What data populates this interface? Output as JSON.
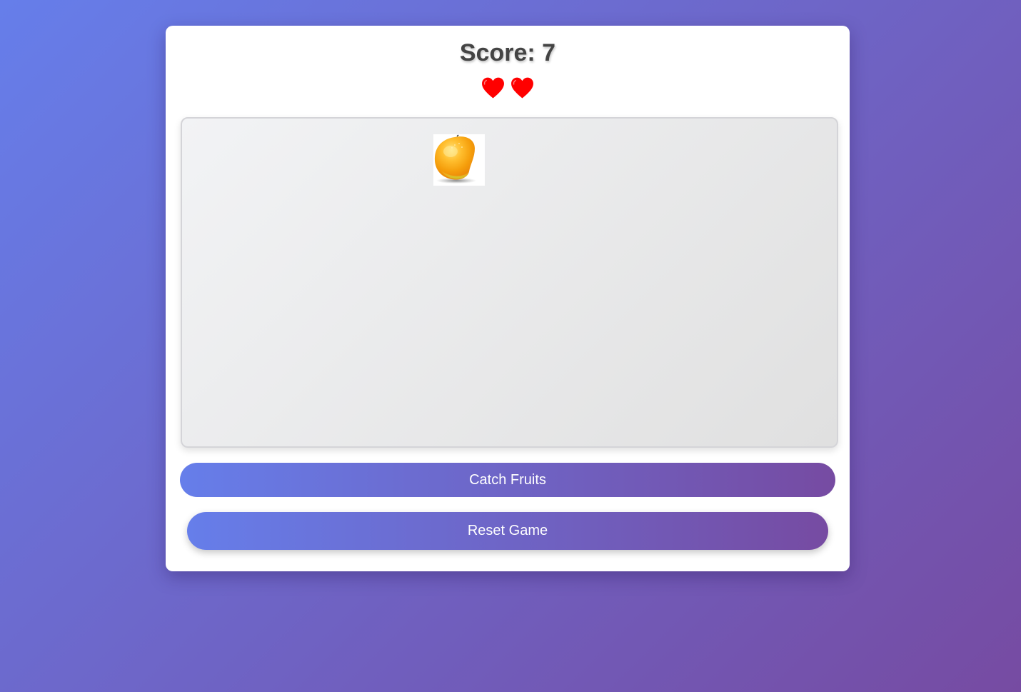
{
  "header": {
    "score_text": "Score: 7"
  },
  "lives": {
    "count": 2,
    "icon": "heart-icon",
    "color": "#ff0000"
  },
  "play_area": {
    "fruit": {
      "type": "mango",
      "icon": "mango-icon"
    }
  },
  "buttons": {
    "catch_label": "Catch Fruits",
    "reset_label": "Reset Game"
  },
  "colors": {
    "background_start": "#667eea",
    "background_end": "#764ba2",
    "card": "#ffffff",
    "score_text": "#444444"
  }
}
